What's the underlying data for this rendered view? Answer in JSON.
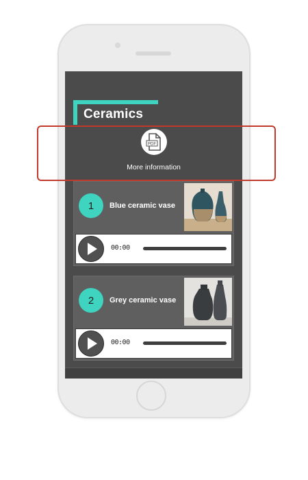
{
  "page": {
    "title": "Ceramics",
    "pdf_link_label": "More information",
    "pdf_icon_text": "PDF"
  },
  "colors": {
    "accent": "#3fd4bf",
    "screen_bg": "#4b4b4b",
    "card_bg": "#5f5f5f",
    "highlight": "#c0392b"
  },
  "items": [
    {
      "number": "1",
      "title": "Blue ceramic vase",
      "image": "blue-vase-photo",
      "player": {
        "time": "00:00",
        "progress": 0
      }
    },
    {
      "number": "2",
      "title": "Grey ceramic vase",
      "image": "grey-vase-photo",
      "player": {
        "time": "00:00",
        "progress": 0
      }
    }
  ]
}
